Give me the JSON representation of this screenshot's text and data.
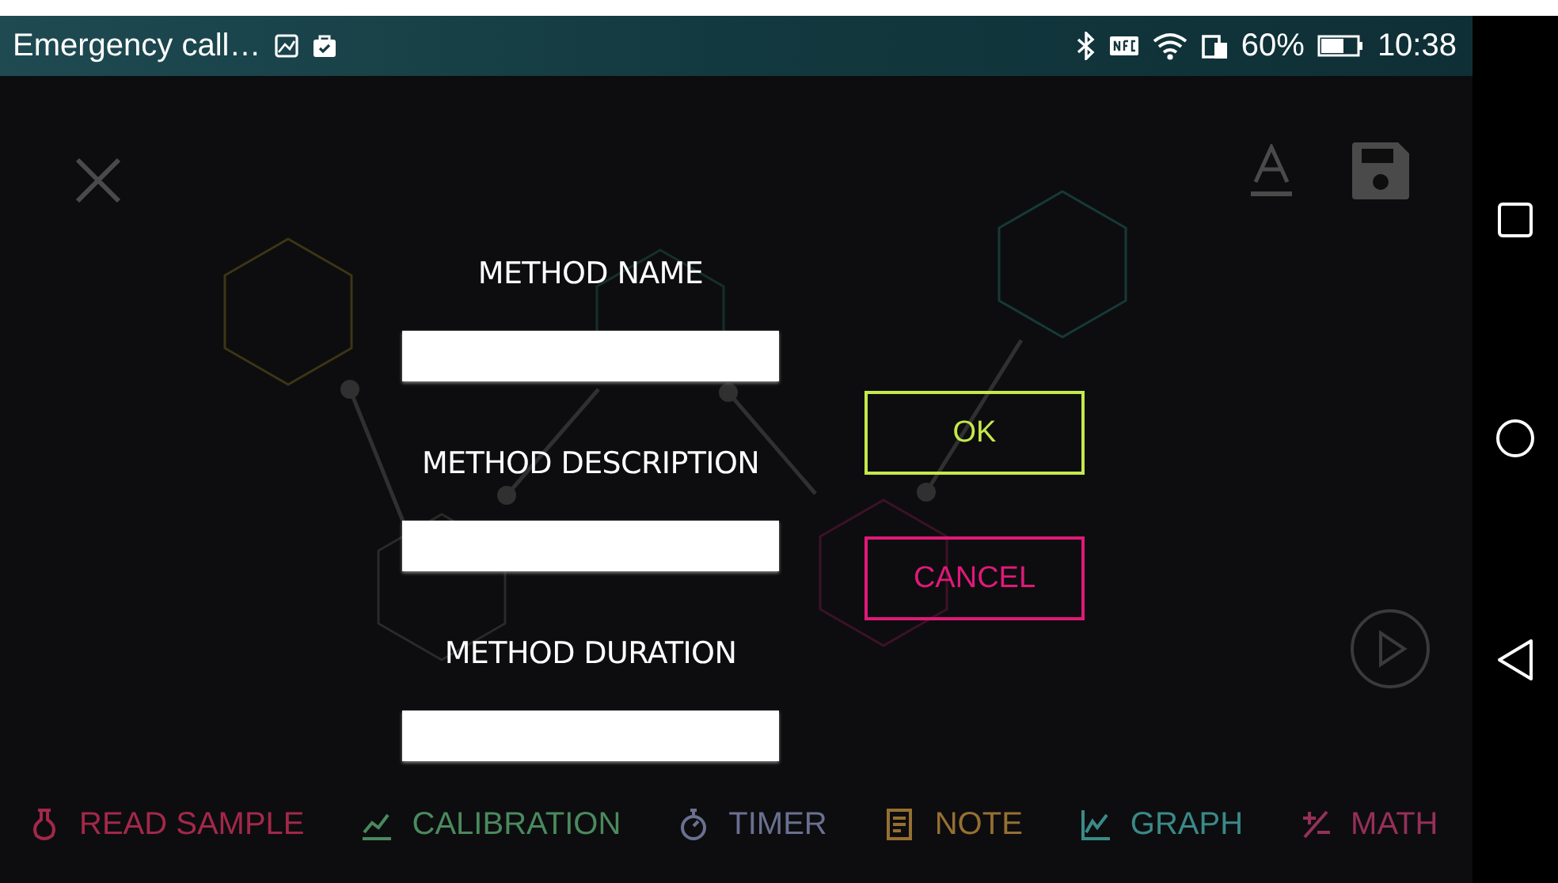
{
  "status_bar": {
    "carrier": "Emergency call…",
    "battery": "60%",
    "time": "10:38"
  },
  "form": {
    "fields": [
      {
        "label": "METHOD NAME"
      },
      {
        "label": "METHOD DESCRIPTION"
      },
      {
        "label": "METHOD DURATION"
      }
    ]
  },
  "buttons": [
    {
      "label": "OK",
      "color": "#c5e84a"
    },
    {
      "label": "CANCEL",
      "color": "#e0197a"
    }
  ],
  "bottom_tabs": [
    {
      "label": "READ SAMPLE",
      "color": "#a3284a"
    },
    {
      "label": "CALIBRATION",
      "color": "#4a8a5e"
    },
    {
      "label": "TIMER",
      "color": "#6a7090"
    },
    {
      "label": "NOTE",
      "color": "#967032"
    },
    {
      "label": "GRAPH",
      "color": "#3a8a88"
    },
    {
      "label": "MATH",
      "color": "#963058"
    }
  ]
}
